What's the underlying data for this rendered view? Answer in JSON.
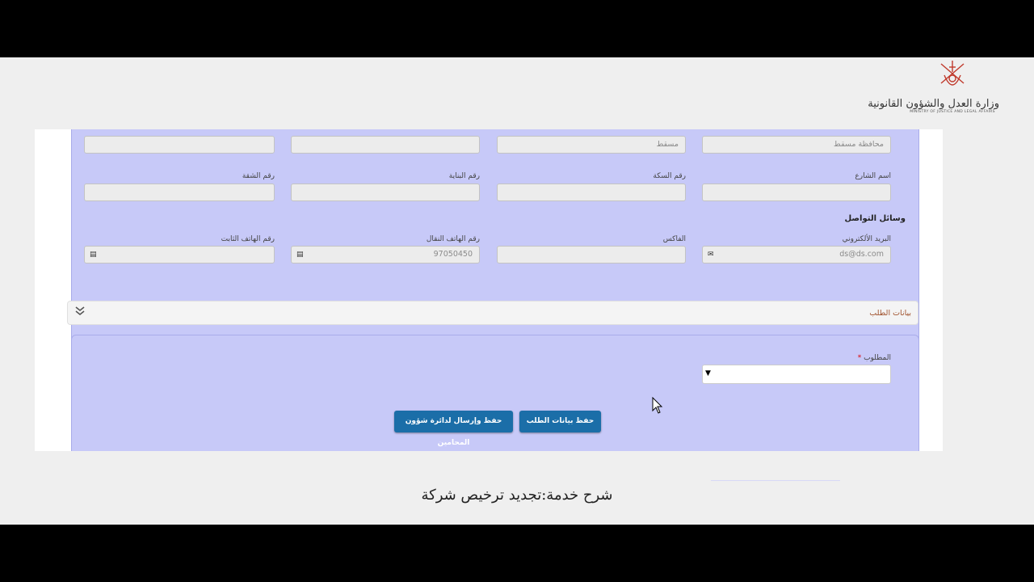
{
  "branding": {
    "ministry_ar": "وزارة العدل والشؤون القانونية",
    "ministry_en": "MINISTRY OF JUSTICE AND LEGAL AFFAIRS"
  },
  "address_section": {
    "row1": {
      "governorate_value": "محافظة مسقط",
      "wilayat_value": "مسقط"
    },
    "row2": {
      "street_label": "اسم الشارع",
      "way_label": "رقم السكة",
      "building_label": "رقم البناية",
      "flat_label": "رقم الشقة"
    }
  },
  "contact_section": {
    "title": "وسائل التواصل",
    "email_label": "البريد الألكتروني",
    "email_value": "ds@ds.com",
    "fax_label": "الفاكس",
    "mobile_label": "رقم الهاتف النقال",
    "mobile_value": "97050450",
    "phone_label": "رقم الهاتف الثابت"
  },
  "request_section": {
    "title": "بيانات الطلب",
    "required_label": "المطلوب",
    "required_marker": "*",
    "select_value": "",
    "save_button": "حفظ بيانات الطلب",
    "save_send_button": "حفظ وإرسال لدائرة شؤون المحامين"
  },
  "caption": "شرح خدمة:تجديد ترخيص شركة",
  "icons": {
    "email": "envelope-icon",
    "phone": "phone-icon",
    "expand": "double-chevron-down-icon",
    "dropdown": "triangle-down-icon",
    "cursor": "mouse-pointer-icon"
  },
  "colors": {
    "panel": "#c7c9f8",
    "button": "#1b6ea8",
    "accordion_title": "#a0522d"
  }
}
